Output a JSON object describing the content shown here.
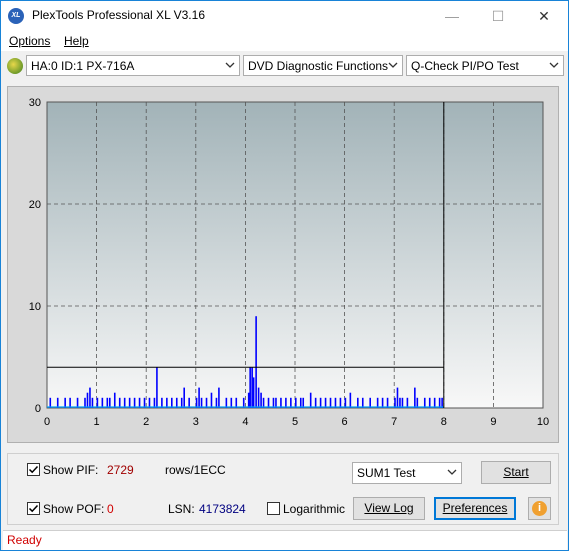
{
  "window": {
    "title": "PlexTools Professional XL V3.16",
    "icon_label": "XL"
  },
  "title_buttons": {
    "minimize": "—",
    "maximize": "☐",
    "close": "✕"
  },
  "menu": {
    "options": "Options",
    "help": "Help"
  },
  "toolbar": {
    "drive": "HA:0 ID:1  PX-716A",
    "function": "DVD Diagnostic Functions",
    "test": "Q-Check PI/PO Test"
  },
  "chart_data": {
    "type": "bar",
    "x_ticks": [
      "0",
      "1",
      "2",
      "3",
      "4",
      "5",
      "6",
      "7",
      "8",
      "9",
      "10"
    ],
    "y_ticks": [
      "0",
      "10",
      "20",
      "30"
    ],
    "xlim": [
      0,
      10
    ],
    "ylim": [
      0,
      30
    ],
    "threshold": 4,
    "progress_x": 8,
    "grid": true,
    "bar_color": "#0000ff",
    "series": [
      {
        "values": [
          [
            0.05,
            1
          ],
          [
            0.2,
            1
          ],
          [
            0.35,
            1
          ],
          [
            0.45,
            1
          ],
          [
            0.6,
            1
          ],
          [
            0.75,
            1
          ],
          [
            0.8,
            1.5
          ],
          [
            0.85,
            2
          ],
          [
            0.9,
            1
          ],
          [
            1.0,
            1
          ],
          [
            1.1,
            1
          ],
          [
            1.2,
            1
          ],
          [
            1.25,
            1
          ],
          [
            1.35,
            1.5
          ],
          [
            1.45,
            1
          ],
          [
            1.55,
            1
          ],
          [
            1.65,
            1
          ],
          [
            1.75,
            1
          ],
          [
            1.85,
            1
          ],
          [
            1.95,
            1
          ],
          [
            2.05,
            1
          ],
          [
            2.15,
            1
          ],
          [
            2.2,
            4
          ],
          [
            2.3,
            1
          ],
          [
            2.4,
            1
          ],
          [
            2.5,
            1
          ],
          [
            2.6,
            1
          ],
          [
            2.7,
            1
          ],
          [
            2.75,
            2
          ],
          [
            2.85,
            1
          ],
          [
            3.0,
            1
          ],
          [
            3.05,
            2
          ],
          [
            3.1,
            1
          ],
          [
            3.2,
            1
          ],
          [
            3.3,
            1.5
          ],
          [
            3.4,
            1
          ],
          [
            3.45,
            2
          ],
          [
            3.6,
            1
          ],
          [
            3.7,
            1
          ],
          [
            3.8,
            1
          ],
          [
            3.95,
            1
          ],
          [
            4.05,
            1.5
          ],
          [
            4.08,
            4
          ],
          [
            4.12,
            4
          ],
          [
            4.15,
            3
          ],
          [
            4.2,
            9
          ],
          [
            4.25,
            2
          ],
          [
            4.3,
            1.5
          ],
          [
            4.35,
            1
          ],
          [
            4.45,
            1
          ],
          [
            4.55,
            1
          ],
          [
            4.6,
            1
          ],
          [
            4.7,
            1
          ],
          [
            4.8,
            1
          ],
          [
            4.9,
            1
          ],
          [
            5.0,
            1
          ],
          [
            5.1,
            1
          ],
          [
            5.15,
            1
          ],
          [
            5.3,
            1.5
          ],
          [
            5.4,
            1
          ],
          [
            5.5,
            1
          ],
          [
            5.6,
            1
          ],
          [
            5.7,
            1
          ],
          [
            5.8,
            1
          ],
          [
            5.9,
            1
          ],
          [
            6.0,
            1
          ],
          [
            6.1,
            1.5
          ],
          [
            6.25,
            1
          ],
          [
            6.35,
            1
          ],
          [
            6.5,
            1
          ],
          [
            6.65,
            1
          ],
          [
            6.75,
            1
          ],
          [
            6.85,
            1
          ],
          [
            7.0,
            1
          ],
          [
            7.05,
            2
          ],
          [
            7.1,
            1
          ],
          [
            7.15,
            1
          ],
          [
            7.25,
            1
          ],
          [
            7.4,
            2
          ],
          [
            7.45,
            1
          ],
          [
            7.6,
            1
          ],
          [
            7.7,
            1
          ],
          [
            7.8,
            1
          ],
          [
            7.9,
            1
          ],
          [
            7.95,
            1
          ]
        ]
      }
    ]
  },
  "controls": {
    "show_pif_label": "Show PIF:",
    "pif_value": "2729",
    "pif_unit": "rows/1ECC",
    "show_pof_label": "Show POF:",
    "pof_value": "0",
    "lsn_label": "LSN:",
    "lsn_value": "4173824",
    "logarithmic_label": "Logarithmic",
    "sum_test": "SUM1 Test",
    "start": "Start",
    "view_log": "View Log",
    "preferences": "Preferences",
    "info_icon": "i",
    "show_pif_checked": true,
    "show_pof_checked": true,
    "logarithmic_checked": false
  },
  "status": {
    "text": "Ready"
  }
}
